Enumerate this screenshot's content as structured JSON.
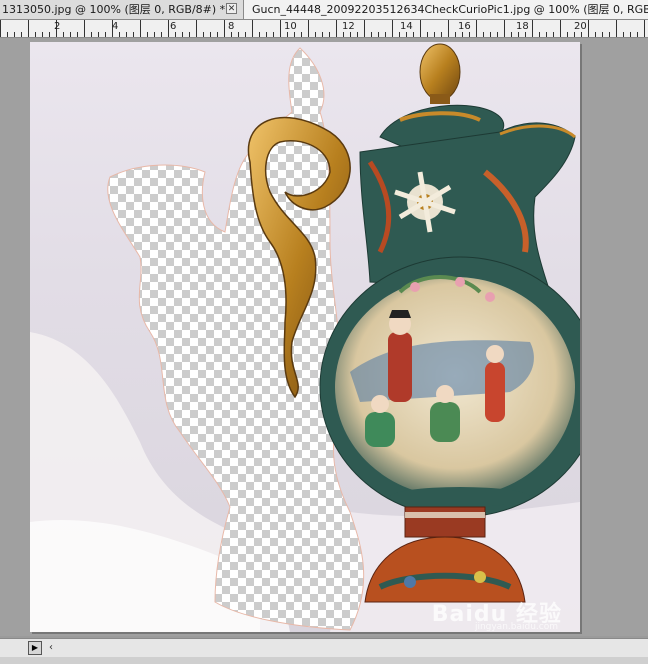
{
  "tabs": [
    {
      "label": "1313050.jpg @ 100% (图层 0, RGB/8#) *",
      "active": false
    },
    {
      "label": "Gucn_44448_20092203512634CheckCurioPic1.jpg @ 100% (图层 0, RGB/8",
      "active": true
    }
  ],
  "ruler": {
    "labels": [
      "2",
      "4",
      "6",
      "8",
      "10",
      "12",
      "14",
      "16",
      "18",
      "20"
    ]
  },
  "canvas": {
    "description_icon": "vase-image",
    "watermark": "Baidu 经验",
    "watermark_sub": "jingyan.baidu.com"
  },
  "scrollbar": {
    "play_icon": "play-icon",
    "left_icon": "arrow-left-icon"
  },
  "colors": {
    "accent_gold": "#c88a2a",
    "vase_green": "#2f5a52",
    "vase_red": "#9a3a22"
  }
}
